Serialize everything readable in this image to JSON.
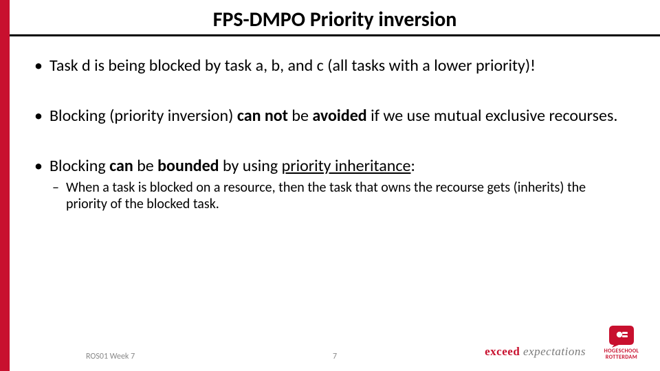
{
  "title": "FPS-DMPO Priority inversion",
  "bullets": {
    "b1": "Task d is being blocked by task a, b, and c (all tasks with a lower priority)!",
    "b2a": "Blocking (priority inversion) ",
    "b2b": "can not",
    "b2c": " be ",
    "b2d": "avoided",
    "b2e": " if we use mutual exclusive recourses.",
    "b3a": "Blocking ",
    "b3b": "can",
    "b3c": " be ",
    "b3d": "bounded",
    "b3e": " by using ",
    "b3f": "priority inheritance",
    "b3g": ":",
    "sub1": "When a task is blocked on a resource, then the task that owns the recourse gets (inherits) the priority of the blocked task."
  },
  "footer": {
    "left": "ROS01 Week 7",
    "page": "7"
  },
  "brand": {
    "word1": "exceed",
    "word2": " expectations"
  },
  "logo": {
    "line1": "HOGESCHOOL",
    "line2": "ROTTERDAM"
  }
}
